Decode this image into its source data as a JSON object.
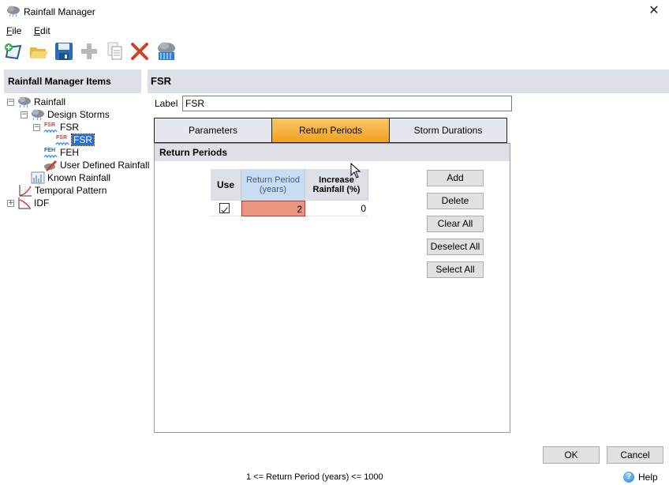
{
  "window": {
    "title": "Rainfall Manager",
    "close_icon": "close-icon"
  },
  "menu": [
    {
      "label": "File",
      "mnemonic": "F",
      "rest": "ile"
    },
    {
      "label": "Edit",
      "mnemonic": "E",
      "rest": "dit"
    }
  ],
  "toolbar": [
    {
      "name": "new-icon",
      "tooltip": "New"
    },
    {
      "name": "open-folder-icon",
      "tooltip": "Open"
    },
    {
      "name": "save-icon",
      "tooltip": "Save"
    },
    {
      "name": "add-icon",
      "tooltip": "Add",
      "disabled": true
    },
    {
      "name": "copy-icon",
      "tooltip": "Copy",
      "disabled": true
    },
    {
      "name": "delete-icon",
      "tooltip": "Delete"
    },
    {
      "name": "rainfall-icon",
      "tooltip": "Rainfall"
    }
  ],
  "left_panel": {
    "title": "Rainfall Manager Items",
    "tree": [
      {
        "label": "Rainfall",
        "icon": "cloud-rain-icon",
        "expander": "−",
        "level": 0
      },
      {
        "label": "Design Storms",
        "icon": "cloud-rain-icon",
        "expander": "−",
        "level": 1
      },
      {
        "label": "FSR",
        "icon": "fsr-icon",
        "expander": "−",
        "level": 2
      },
      {
        "label": "FSR",
        "icon": "fsr-icon",
        "expander": "",
        "level": 3,
        "selected": true
      },
      {
        "label": "FEH",
        "icon": "feh-icon",
        "expander": "",
        "level": 2
      },
      {
        "label": "User Defined Rainfall",
        "icon": "pencil-icon",
        "expander": "",
        "level": 2
      },
      {
        "label": "Known Rainfall",
        "icon": "known-rainfall-icon",
        "expander": "",
        "level": 1
      },
      {
        "label": "Temporal Pattern",
        "icon": "temporal-chart-icon",
        "expander": "",
        "level": 0
      },
      {
        "label": "IDF",
        "icon": "idf-chart-icon",
        "expander": "+",
        "level": 0
      }
    ]
  },
  "detail": {
    "header": "FSR",
    "label_caption": "Label",
    "label_value": "FSR",
    "tabs": [
      {
        "label": "Parameters",
        "active": false
      },
      {
        "label": "Return Periods",
        "active": true
      },
      {
        "label": "Storm Durations",
        "active": false
      }
    ],
    "section_title": "Return Periods",
    "grid": {
      "columns": [
        "Use",
        "Return Period\n(years)",
        "Increase\nRainfall (%)"
      ],
      "rows": [
        {
          "use": true,
          "return_period": "2",
          "increase_rainfall": "0"
        }
      ]
    },
    "buttons": [
      "Add",
      "Delete",
      "Clear All",
      "Deselect All",
      "Select All"
    ]
  },
  "footer": {
    "ok": "OK",
    "cancel": "Cancel",
    "status": "1 <= Return Period (years) <= 1000",
    "help": "Help"
  },
  "colors": {
    "active_tab": "#f0a020",
    "selected_tree": "#2a6fd1",
    "invalid_cell": "#e8967e",
    "header_bg": "#dde1e7"
  }
}
